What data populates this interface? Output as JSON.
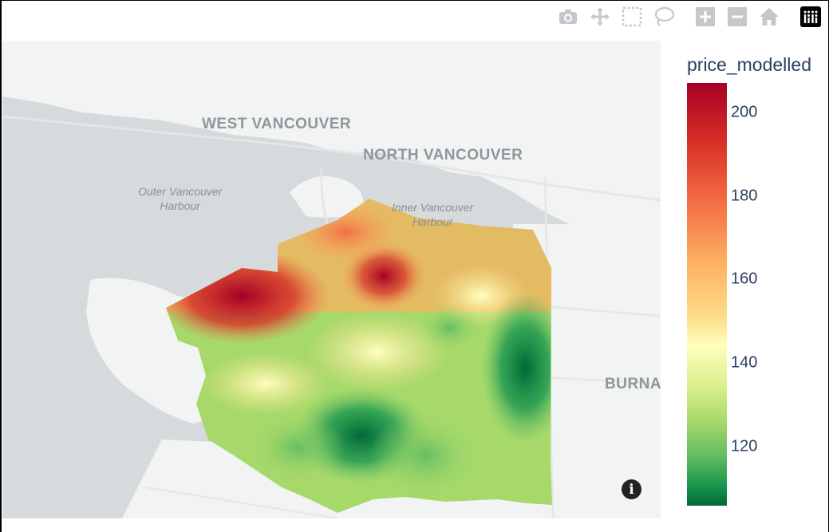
{
  "modebar": {
    "buttons": [
      {
        "name": "camera-icon"
      },
      {
        "name": "pan-icon"
      },
      {
        "name": "box-select-icon"
      },
      {
        "name": "lasso-select-icon"
      },
      {
        "name": "zoom-in-icon"
      },
      {
        "name": "zoom-out-icon"
      },
      {
        "name": "reset-home-icon"
      },
      {
        "name": "plotly-logo-icon"
      }
    ]
  },
  "map": {
    "place_labels": [
      "WEST VANCOUVER",
      "NORTH VANCOUVER",
      "BURNA"
    ],
    "water_labels": [
      "Outer Vancouver\nHarbour",
      "Inner Vancouver\nHarbour"
    ],
    "info_symbol": "i"
  },
  "colorbar": {
    "title": "price_modelled",
    "ticks": [
      "200",
      "180",
      "160",
      "140",
      "120"
    ],
    "colors": [
      "#a50026",
      "#d73027",
      "#f46d43",
      "#fdae61",
      "#fee08b",
      "#ffffbf",
      "#d9ef8b",
      "#a6d96a",
      "#66bd63",
      "#1a9850",
      "#006837"
    ],
    "min": 106,
    "max": 207
  },
  "colors": {
    "water": "#d6dadd",
    "land": "#f2f3f3",
    "label": "#8f969c",
    "axis_text": "#2a3f5f"
  }
}
